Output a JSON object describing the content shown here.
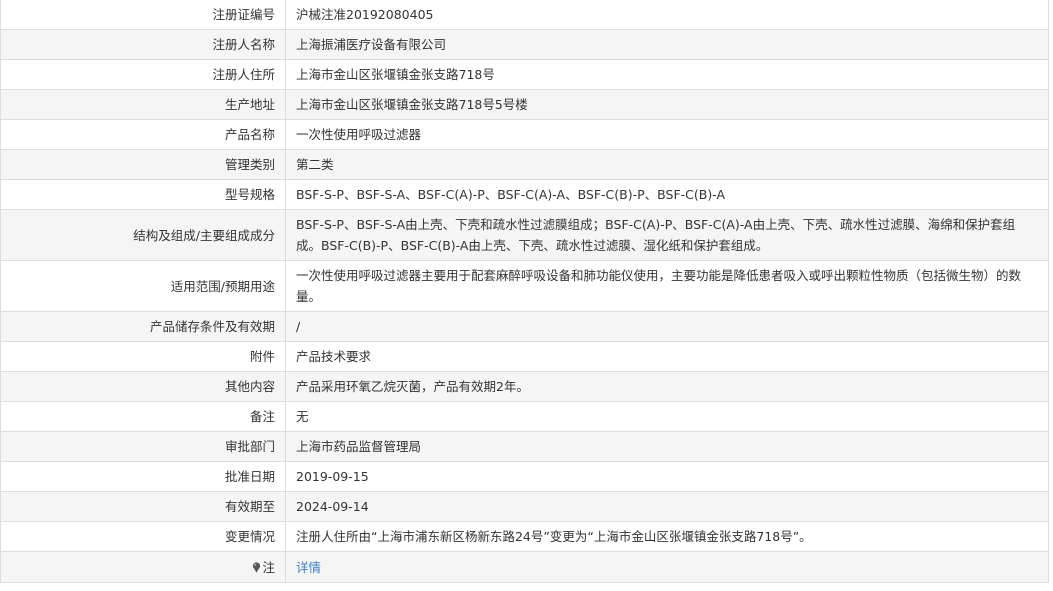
{
  "rows": [
    {
      "label": "注册证编号",
      "value": "沪械注准20192080405"
    },
    {
      "label": "注册人名称",
      "value": "上海振浦医疗设备有限公司"
    },
    {
      "label": "注册人住所",
      "value": "上海市金山区张堰镇金张支路718号"
    },
    {
      "label": "生产地址",
      "value": "上海市金山区张堰镇金张支路718号5号楼"
    },
    {
      "label": "产品名称",
      "value": "一次性使用呼吸过滤器"
    },
    {
      "label": "管理类别",
      "value": "第二类"
    },
    {
      "label": "型号规格",
      "value": "BSF-S-P、BSF-S-A、BSF-C(A)-P、BSF-C(A)-A、BSF-C(B)-P、BSF-C(B)-A"
    },
    {
      "label": "结构及组成/主要组成成分",
      "value": "BSF-S-P、BSF-S-A由上壳、下壳和疏水性过滤膜组成；BSF-C(A)-P、BSF-C(A)-A由上壳、下壳、疏水性过滤膜、海绵和保护套组成。BSF-C(B)-P、BSF-C(B)-A由上壳、下壳、疏水性过滤膜、湿化纸和保护套组成。"
    },
    {
      "label": "适用范围/预期用途",
      "value": "一次性使用呼吸过滤器主要用于配套麻醉呼吸设备和肺功能仪使用，主要功能是降低患者吸入或呼出颗粒性物质（包括微生物）的数量。"
    },
    {
      "label": "产品储存条件及有效期",
      "value": "/"
    },
    {
      "label": "附件",
      "value": "产品技术要求"
    },
    {
      "label": "其他内容",
      "value": "产品采用环氧乙烷灭菌，产品有效期2年。"
    },
    {
      "label": "备注",
      "value": "无"
    },
    {
      "label": "审批部门",
      "value": "上海市药品监督管理局"
    },
    {
      "label": "批准日期",
      "value": "2019-09-15"
    },
    {
      "label": "有效期至",
      "value": "2024-09-14"
    },
    {
      "label": "变更情况",
      "value": "注册人住所由“上海市浦东新区杨新东路24号”变更为“上海市金山区张堰镇金张支路718号”。"
    }
  ],
  "note_row": {
    "label": "注",
    "link_text": "详情",
    "icon": "note-pin-icon"
  },
  "colors": {
    "link": "#3f7fc8",
    "stripe": "#f5f5f5",
    "border": "#dddddd"
  }
}
